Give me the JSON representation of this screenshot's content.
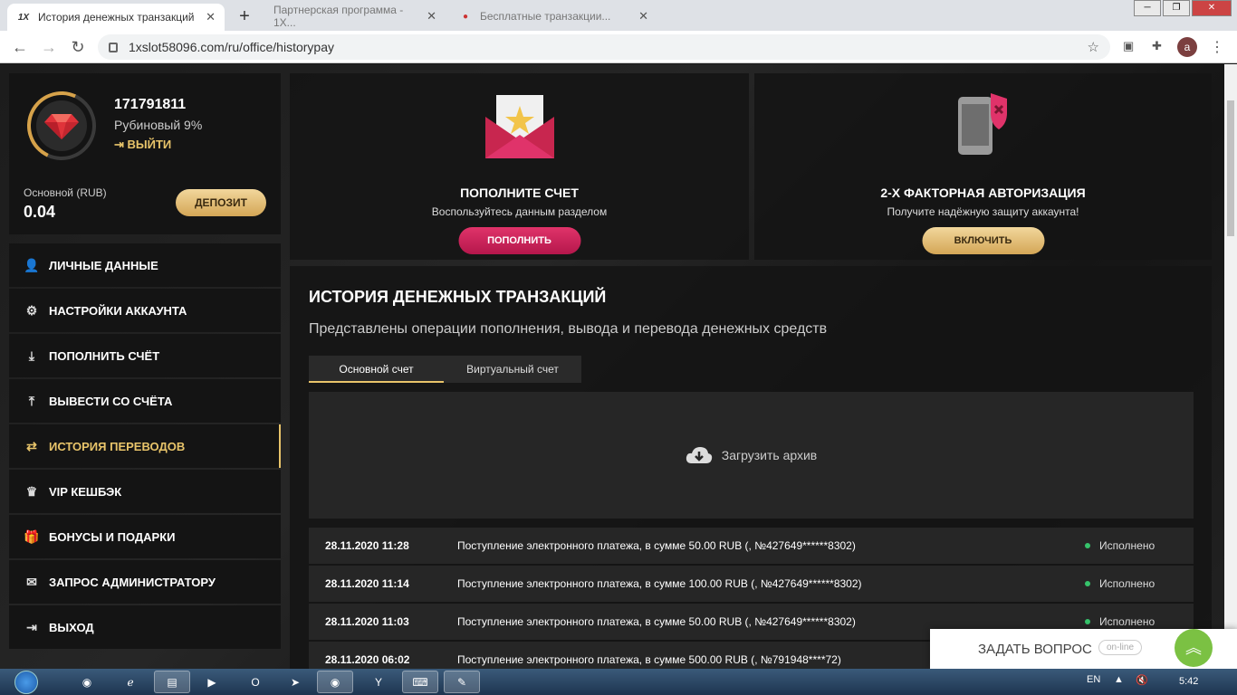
{
  "browser": {
    "active_tab": {
      "title": "История денежных транзакций",
      "favicon": "1X"
    },
    "bg_tabs": [
      {
        "title": "Партнерская программа - 1X..."
      },
      {
        "title": "Бесплатные транзакции..."
      }
    ],
    "url": "1xslot58096.com/ru/office/historypay",
    "avatar_letter": "a"
  },
  "profile": {
    "user_id": "171791811",
    "status": "Рубиновый 9%",
    "logout": "ВЫЙТИ",
    "balance_label": "Основной (RUB)",
    "balance": "0.04",
    "deposit_btn": "ДЕПОЗИТ"
  },
  "menu": [
    {
      "label": "ЛИЧНЫЕ ДАННЫЕ",
      "icon": "user-plus-icon",
      "glyph": "👤"
    },
    {
      "label": "НАСТРОЙКИ АККАУНТА",
      "icon": "gears-icon",
      "glyph": "⚙"
    },
    {
      "label": "ПОПОЛНИТЬ СЧЁТ",
      "icon": "download-icon",
      "glyph": "⤓"
    },
    {
      "label": "ВЫВЕСТИ СО СЧЁТА",
      "icon": "upload-icon",
      "glyph": "⤒"
    },
    {
      "label": "ИСТОРИЯ ПЕРЕВОДОВ",
      "icon": "transfer-icon",
      "glyph": "⇄"
    },
    {
      "label": "VIP КЕШБЭК",
      "icon": "crown-icon",
      "glyph": "♛"
    },
    {
      "label": "БОНУСЫ И ПОДАРКИ",
      "icon": "gift-icon",
      "glyph": "🎁"
    },
    {
      "label": "ЗАПРОС АДМИНИСТРАТОРУ",
      "icon": "envelope-icon",
      "glyph": "✉"
    },
    {
      "label": "ВЫХОД",
      "icon": "exit-icon",
      "glyph": "⇥"
    }
  ],
  "promo_deposit": {
    "title": "ПОПОЛНИТЕ СЧЕТ",
    "subtitle": "Воспользуйтесь данным разделом",
    "button": "ПОПОЛНИТЬ"
  },
  "promo_2fa": {
    "title": "2-Х ФАКТОРНАЯ АВТОРИЗАЦИЯ",
    "subtitle": "Получите надёжную защиту аккаунта!",
    "button": "ВКЛЮЧИТЬ"
  },
  "history": {
    "title": "ИСТОРИЯ ДЕНЕЖНЫХ ТРАНЗАКЦИЙ",
    "subtitle": "Представлены операции пополнения, вывода и перевода денежных средств",
    "tab_main": "Основной счет",
    "tab_virtual": "Виртуальный счет",
    "archive": "Загрузить архив",
    "rows": [
      {
        "date": "28.11.2020 11:28",
        "desc": "Поступление электронного платежа, в сумме 50.00 RUB (, №427649******8302)",
        "status": "Исполнено"
      },
      {
        "date": "28.11.2020 11:14",
        "desc": "Поступление электронного платежа, в сумме 100.00 RUB (, №427649******8302)",
        "status": "Исполнено"
      },
      {
        "date": "28.11.2020 11:03",
        "desc": "Поступление электронного платежа, в сумме 50.00 RUB (, №427649******8302)",
        "status": "Исполнено"
      },
      {
        "date": "28.11.2020 06:02",
        "desc": "Поступление электронного платежа, в сумме 500.00 RUB (, №791948****72)",
        "status": ""
      }
    ]
  },
  "chat": {
    "ask": "ЗАДАТЬ ВОПРОС",
    "online": "on-line"
  },
  "taskbar": {
    "lang": "EN",
    "time": "5:42"
  }
}
